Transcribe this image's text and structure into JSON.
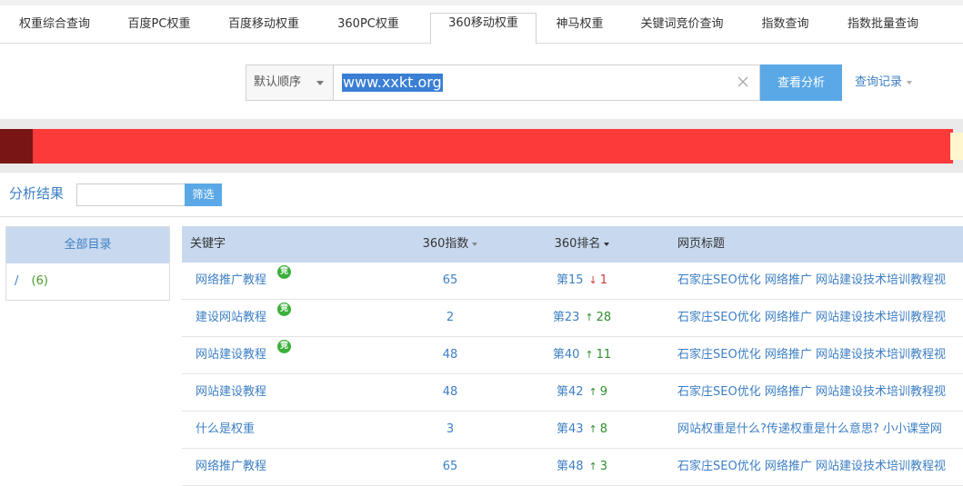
{
  "tabs": [
    {
      "label": "权重综合查询",
      "active": false
    },
    {
      "label": "百度PC权重",
      "active": false
    },
    {
      "label": "百度移动权重",
      "active": false
    },
    {
      "label": "360PC权重",
      "active": false
    },
    {
      "label": "360移动权重",
      "active": true
    },
    {
      "label": "神马权重",
      "active": false
    },
    {
      "label": "关键词竞价查询",
      "active": false
    },
    {
      "label": "指数查询",
      "active": false
    },
    {
      "label": "指数批量查询",
      "active": false
    }
  ],
  "search": {
    "sort_label": "默认顺序",
    "query": "www.xxkt.org",
    "analyze_label": "查看分析",
    "history_label": "查询记录"
  },
  "filter": {
    "title": "分析结果",
    "button_label": "筛选"
  },
  "sidebar": {
    "head": "全部目录",
    "item_slash": "/",
    "item_count": "(6)"
  },
  "table": {
    "headers": {
      "keyword": "关键字",
      "index": "360指数",
      "rank": "360排名",
      "title": "网页标题"
    },
    "bid_badge": "竞",
    "rows": [
      {
        "keyword": "网络推广教程",
        "bid": true,
        "index": "65",
        "rank": "第15",
        "trend": "down",
        "change": "1",
        "title": "石家庄SEO优化 网络推广 网站建设技术培训教程视"
      },
      {
        "keyword": "建设网站教程",
        "bid": true,
        "index": "2",
        "rank": "第23",
        "trend": "up",
        "change": "28",
        "title": "石家庄SEO优化 网络推广 网站建设技术培训教程视"
      },
      {
        "keyword": "网站建设教程",
        "bid": true,
        "index": "48",
        "rank": "第40",
        "trend": "up",
        "change": "11",
        "title": "石家庄SEO优化 网络推广 网站建设技术培训教程视"
      },
      {
        "keyword": "网站建设教程",
        "bid": false,
        "index": "48",
        "rank": "第42",
        "trend": "up",
        "change": "9",
        "title": "石家庄SEO优化 网络推广 网站建设技术培训教程视"
      },
      {
        "keyword": "什么是权重",
        "bid": false,
        "index": "3",
        "rank": "第43",
        "trend": "up",
        "change": "8",
        "title": "网站权重是什么?传递权重是什么意思? 小小课堂网"
      },
      {
        "keyword": "网络推广教程",
        "bid": false,
        "index": "65",
        "rank": "第48",
        "trend": "up",
        "change": "3",
        "title": "石家庄SEO优化 网络推广 网站建设技术培训教程视"
      }
    ]
  },
  "colors": {
    "accent": "#3d7fc4",
    "button": "#5aa8e6",
    "header_bg": "#c8d9ef",
    "up": "#2f8f2f",
    "down": "#d23a3a",
    "badge": "#3cb03c"
  }
}
